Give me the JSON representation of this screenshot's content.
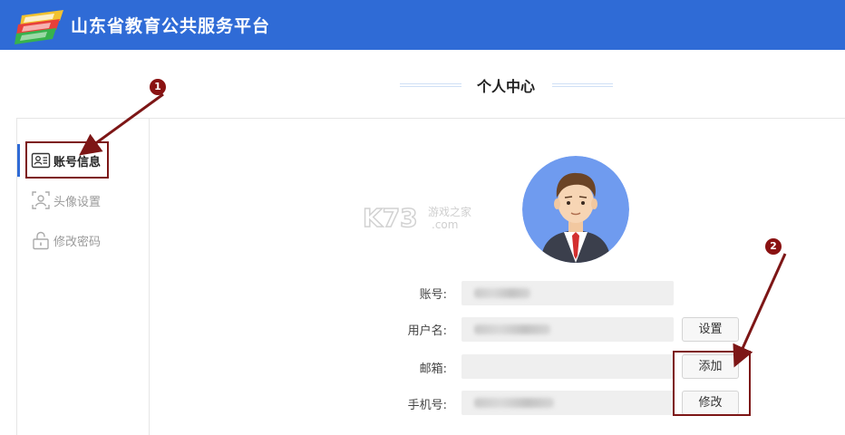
{
  "header": {
    "brand": "山东省教育公共服务平台",
    "logo_icon": "platform-logo-icon",
    "bg_color": "#2f6bd6"
  },
  "page": {
    "title": "个人中心"
  },
  "sidebar": {
    "items": [
      {
        "label": "账号信息",
        "icon": "id-card-icon",
        "active": true
      },
      {
        "label": "头像设置",
        "icon": "user-portrait-icon",
        "active": false
      },
      {
        "label": "修改密码",
        "icon": "unlock-icon",
        "active": false
      }
    ]
  },
  "profile": {
    "avatar_icon": "businessman-avatar-icon",
    "rows": [
      {
        "label": "账号:",
        "value": "",
        "button": ""
      },
      {
        "label": "用户名:",
        "value": "",
        "button": "设置"
      },
      {
        "label": "邮箱:",
        "value": "",
        "button": "添加"
      },
      {
        "label": "手机号:",
        "value": "",
        "button": "修改"
      }
    ]
  },
  "annotations": {
    "marker_1": "1",
    "marker_2": "2",
    "color": "#7d1616"
  },
  "watermark": {
    "brand": "K73",
    "tagline": "游戏之家",
    "domain": ".com"
  }
}
